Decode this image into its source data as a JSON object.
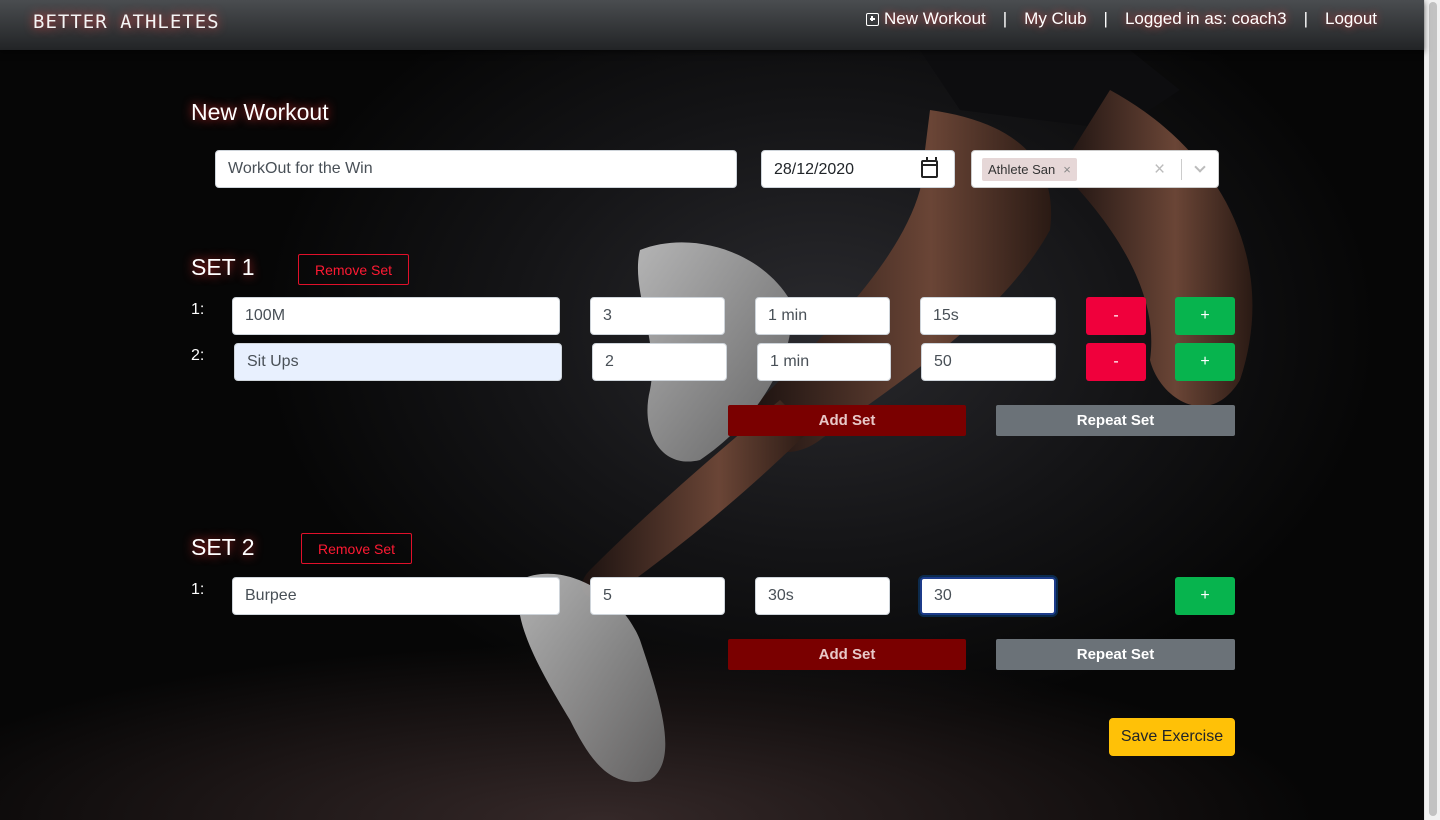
{
  "navbar": {
    "brand": "BETTER ATHLETES",
    "new_workout": "New Workout",
    "separator": "|",
    "my_club": "My Club",
    "logged_in": "Logged in as: coach3",
    "logout": "Logout"
  },
  "form": {
    "title": "New Workout",
    "workout_name": "WorkOut for the Win",
    "date": "28/12/2020",
    "athlete_chip": "Athlete San",
    "chip_remove": "×",
    "clear_all": "×"
  },
  "sets": [
    {
      "title": "SET 1",
      "remove_label": "Remove Set",
      "rows": [
        {
          "label": "1:",
          "exercise": "100M",
          "reps": "3",
          "rest": "1 min",
          "amount": "15s"
        },
        {
          "label": "2:",
          "exercise": "Sit Ups",
          "reps": "2",
          "rest": "1 min",
          "amount": "50"
        }
      ],
      "add_set": "Add Set",
      "repeat_set": "Repeat Set"
    },
    {
      "title": "SET 2",
      "remove_label": "Remove Set",
      "rows": [
        {
          "label": "1:",
          "exercise": "Burpee",
          "reps": "5",
          "rest": "30s",
          "amount": "30"
        }
      ],
      "add_set": "Add Set",
      "repeat_set": "Repeat Set"
    }
  ],
  "buttons": {
    "minus": "-",
    "plus": "+",
    "save": "Save Exercise"
  },
  "colors": {
    "remove": "#f0003c",
    "add": "#07b44e",
    "add_set": "#7a0000",
    "repeat_set": "#6b7278",
    "save": "#ffc107"
  }
}
